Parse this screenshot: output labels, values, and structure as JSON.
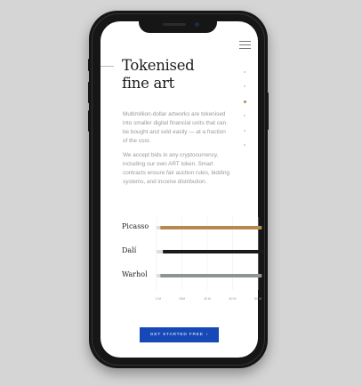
{
  "page": {
    "title_line1": "Tokenised",
    "title_line2": "fine art",
    "para1": "Multimillion-dollar artworks are tokenised into smaller digital financial units that can be bought and sold easily — at a fraction of the cost.",
    "para2": "We accept bids in any cryptocurrency, including our own ART token. Smart contracts ensure fair auction rules, bidding systems, and income distribution.",
    "cta_label": "GET STARTED FREE",
    "cta_icon": "chevron-right-icon"
  },
  "section_nav": {
    "count": 6,
    "active_index": 2
  },
  "colors": {
    "accent_gold": "#b48a4e",
    "bar_black": "#1a1a1a",
    "bar_gray": "#8c9590",
    "bar_track": "#dedede",
    "cta_blue": "#1648b8"
  },
  "chart_data": {
    "type": "bar",
    "orientation": "horizontal",
    "categories": [
      "Picasso",
      "Dalí",
      "Warhol"
    ],
    "series": [
      {
        "values": [
          3,
          5,
          3
        ],
        "color": "#dedede"
      },
      {
        "values": [
          80,
          80,
          80
        ],
        "colors": [
          "#b48a4e",
          "#1a1a1a",
          "#8c9590"
        ]
      }
    ],
    "x_ticks": [
      "0 M",
      "20M",
      "40 M",
      "60 M",
      "80 M"
    ],
    "xlim": [
      0,
      80
    ],
    "grid": true
  }
}
